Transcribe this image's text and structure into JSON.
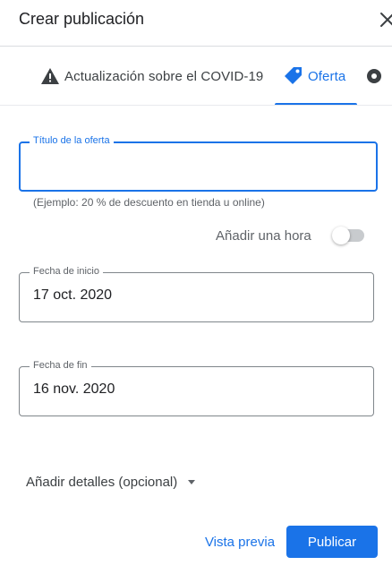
{
  "dialog": {
    "title": "Crear publicación"
  },
  "tabs": [
    {
      "label": "Actualización sobre el COVID-19",
      "icon": "warning-icon",
      "active": false
    },
    {
      "label": "Oferta",
      "icon": "tag-icon",
      "active": true
    },
    {
      "label": "",
      "icon": "event-icon",
      "active": false
    }
  ],
  "offer_title": {
    "label": "Título de la oferta",
    "value": "",
    "helper": "(Ejemplo: 20 % de descuento en tienda u online)"
  },
  "add_hour": {
    "label": "Añadir una hora",
    "enabled": false
  },
  "start_date": {
    "label": "Fecha de inicio",
    "value": "17 oct. 2020"
  },
  "end_date": {
    "label": "Fecha de fin",
    "value": "16 nov. 2020"
  },
  "details": {
    "label": "Añadir detalles (opcional)"
  },
  "actions": {
    "preview_label": "Vista previa",
    "publish_label": "Publicar"
  },
  "colors": {
    "accent": "#1a73e8",
    "text": "#202124",
    "muted": "#5f6368",
    "border": "#80868b"
  }
}
